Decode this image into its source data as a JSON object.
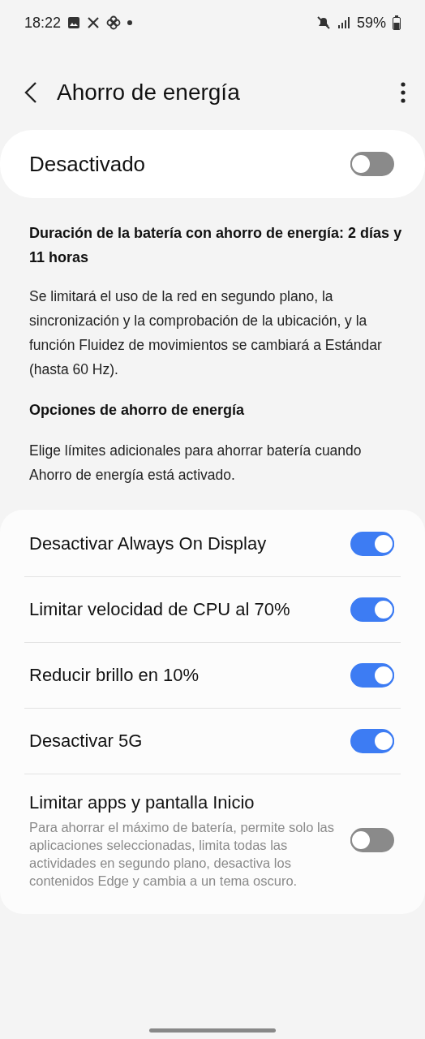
{
  "status_bar": {
    "time": "18:22",
    "battery": "59%"
  },
  "header": {
    "title": "Ahorro de energía"
  },
  "master": {
    "label": "Desactivado",
    "on": false
  },
  "battery_duration": "Duración de la batería con ahorro de energía: 2 días y 11 horas",
  "description": "Se limitará el uso de la red en segundo plano, la sincronización y la comprobación de la ubicación, y la función Fluidez de movimientos se cambiará a Estándar (hasta 60 Hz).",
  "options_heading": "Opciones de ahorro de energía",
  "options_description": "Elige límites adicionales para ahorrar batería cuando Ahorro de energía está activado.",
  "options": [
    {
      "label": "Desactivar Always On Display",
      "on": true
    },
    {
      "label": "Limitar velocidad de CPU al 70%",
      "on": true
    },
    {
      "label": "Reducir brillo en 10%",
      "on": true
    },
    {
      "label": "Desactivar 5G",
      "on": true
    },
    {
      "label": "Limitar apps y pantalla Inicio",
      "on": false,
      "description": "Para ahorrar el máximo de batería, permite solo las aplicaciones seleccionadas, limita todas las actividades en segundo plano, desactiva los contenidos Edge y cambia a un tema oscuro."
    }
  ]
}
